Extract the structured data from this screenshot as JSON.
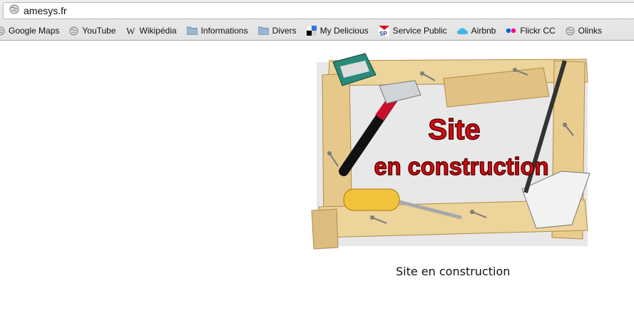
{
  "browser": {
    "url": "amesys.fr",
    "bookmarks": [
      {
        "label": "Google Maps",
        "icon": "globe-icon"
      },
      {
        "label": "YouTube",
        "icon": "globe-icon"
      },
      {
        "label": "Wikipédia",
        "icon": "wikipedia-w-icon"
      },
      {
        "label": "Informations",
        "icon": "folder-icon"
      },
      {
        "label": "Divers",
        "icon": "folder-icon"
      },
      {
        "label": "My Delicious",
        "icon": "delicious-icon"
      },
      {
        "label": "Service Public",
        "icon": "service-public-icon"
      },
      {
        "label": "Airbnb",
        "icon": "cloud-icon"
      },
      {
        "label": "Flickr CC",
        "icon": "flickr-icon"
      },
      {
        "label": "Olinks",
        "icon": "globe-icon"
      }
    ]
  },
  "page": {
    "banner_line1": "Site",
    "banner_line2": "en construction",
    "caption": "Site en construction"
  }
}
